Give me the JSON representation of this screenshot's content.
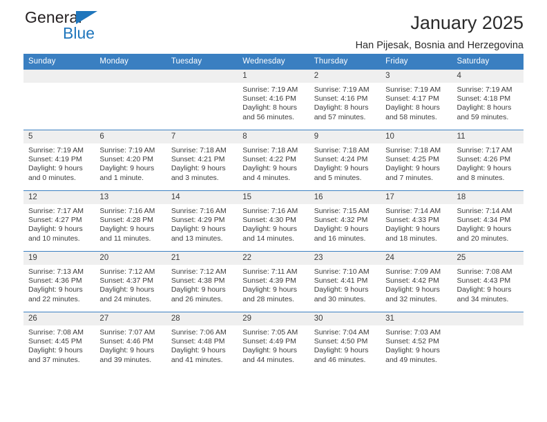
{
  "brand": {
    "line1": "General",
    "line2": "Blue",
    "accent_color": "#1f76bc",
    "triangle_icon": "brand-triangle-icon"
  },
  "header": {
    "title": "January 2025",
    "subtitle": "Han Pijesak, Bosnia and Herzegovina"
  },
  "calendar": {
    "header_bg": "#3a7fc1",
    "daynum_bg": "#efefef",
    "weekdays": [
      "Sunday",
      "Monday",
      "Tuesday",
      "Wednesday",
      "Thursday",
      "Friday",
      "Saturday"
    ],
    "weeks": [
      [
        {
          "day": "",
          "sunrise": "",
          "sunset": "",
          "daylight1": "",
          "daylight2": ""
        },
        {
          "day": "",
          "sunrise": "",
          "sunset": "",
          "daylight1": "",
          "daylight2": ""
        },
        {
          "day": "",
          "sunrise": "",
          "sunset": "",
          "daylight1": "",
          "daylight2": ""
        },
        {
          "day": "1",
          "sunrise": "Sunrise: 7:19 AM",
          "sunset": "Sunset: 4:16 PM",
          "daylight1": "Daylight: 8 hours",
          "daylight2": "and 56 minutes."
        },
        {
          "day": "2",
          "sunrise": "Sunrise: 7:19 AM",
          "sunset": "Sunset: 4:16 PM",
          "daylight1": "Daylight: 8 hours",
          "daylight2": "and 57 minutes."
        },
        {
          "day": "3",
          "sunrise": "Sunrise: 7:19 AM",
          "sunset": "Sunset: 4:17 PM",
          "daylight1": "Daylight: 8 hours",
          "daylight2": "and 58 minutes."
        },
        {
          "day": "4",
          "sunrise": "Sunrise: 7:19 AM",
          "sunset": "Sunset: 4:18 PM",
          "daylight1": "Daylight: 8 hours",
          "daylight2": "and 59 minutes."
        }
      ],
      [
        {
          "day": "5",
          "sunrise": "Sunrise: 7:19 AM",
          "sunset": "Sunset: 4:19 PM",
          "daylight1": "Daylight: 9 hours",
          "daylight2": "and 0 minutes."
        },
        {
          "day": "6",
          "sunrise": "Sunrise: 7:19 AM",
          "sunset": "Sunset: 4:20 PM",
          "daylight1": "Daylight: 9 hours",
          "daylight2": "and 1 minute."
        },
        {
          "day": "7",
          "sunrise": "Sunrise: 7:18 AM",
          "sunset": "Sunset: 4:21 PM",
          "daylight1": "Daylight: 9 hours",
          "daylight2": "and 3 minutes."
        },
        {
          "day": "8",
          "sunrise": "Sunrise: 7:18 AM",
          "sunset": "Sunset: 4:22 PM",
          "daylight1": "Daylight: 9 hours",
          "daylight2": "and 4 minutes."
        },
        {
          "day": "9",
          "sunrise": "Sunrise: 7:18 AM",
          "sunset": "Sunset: 4:24 PM",
          "daylight1": "Daylight: 9 hours",
          "daylight2": "and 5 minutes."
        },
        {
          "day": "10",
          "sunrise": "Sunrise: 7:18 AM",
          "sunset": "Sunset: 4:25 PM",
          "daylight1": "Daylight: 9 hours",
          "daylight2": "and 7 minutes."
        },
        {
          "day": "11",
          "sunrise": "Sunrise: 7:17 AM",
          "sunset": "Sunset: 4:26 PM",
          "daylight1": "Daylight: 9 hours",
          "daylight2": "and 8 minutes."
        }
      ],
      [
        {
          "day": "12",
          "sunrise": "Sunrise: 7:17 AM",
          "sunset": "Sunset: 4:27 PM",
          "daylight1": "Daylight: 9 hours",
          "daylight2": "and 10 minutes."
        },
        {
          "day": "13",
          "sunrise": "Sunrise: 7:16 AM",
          "sunset": "Sunset: 4:28 PM",
          "daylight1": "Daylight: 9 hours",
          "daylight2": "and 11 minutes."
        },
        {
          "day": "14",
          "sunrise": "Sunrise: 7:16 AM",
          "sunset": "Sunset: 4:29 PM",
          "daylight1": "Daylight: 9 hours",
          "daylight2": "and 13 minutes."
        },
        {
          "day": "15",
          "sunrise": "Sunrise: 7:16 AM",
          "sunset": "Sunset: 4:30 PM",
          "daylight1": "Daylight: 9 hours",
          "daylight2": "and 14 minutes."
        },
        {
          "day": "16",
          "sunrise": "Sunrise: 7:15 AM",
          "sunset": "Sunset: 4:32 PM",
          "daylight1": "Daylight: 9 hours",
          "daylight2": "and 16 minutes."
        },
        {
          "day": "17",
          "sunrise": "Sunrise: 7:14 AM",
          "sunset": "Sunset: 4:33 PM",
          "daylight1": "Daylight: 9 hours",
          "daylight2": "and 18 minutes."
        },
        {
          "day": "18",
          "sunrise": "Sunrise: 7:14 AM",
          "sunset": "Sunset: 4:34 PM",
          "daylight1": "Daylight: 9 hours",
          "daylight2": "and 20 minutes."
        }
      ],
      [
        {
          "day": "19",
          "sunrise": "Sunrise: 7:13 AM",
          "sunset": "Sunset: 4:36 PM",
          "daylight1": "Daylight: 9 hours",
          "daylight2": "and 22 minutes."
        },
        {
          "day": "20",
          "sunrise": "Sunrise: 7:12 AM",
          "sunset": "Sunset: 4:37 PM",
          "daylight1": "Daylight: 9 hours",
          "daylight2": "and 24 minutes."
        },
        {
          "day": "21",
          "sunrise": "Sunrise: 7:12 AM",
          "sunset": "Sunset: 4:38 PM",
          "daylight1": "Daylight: 9 hours",
          "daylight2": "and 26 minutes."
        },
        {
          "day": "22",
          "sunrise": "Sunrise: 7:11 AM",
          "sunset": "Sunset: 4:39 PM",
          "daylight1": "Daylight: 9 hours",
          "daylight2": "and 28 minutes."
        },
        {
          "day": "23",
          "sunrise": "Sunrise: 7:10 AM",
          "sunset": "Sunset: 4:41 PM",
          "daylight1": "Daylight: 9 hours",
          "daylight2": "and 30 minutes."
        },
        {
          "day": "24",
          "sunrise": "Sunrise: 7:09 AM",
          "sunset": "Sunset: 4:42 PM",
          "daylight1": "Daylight: 9 hours",
          "daylight2": "and 32 minutes."
        },
        {
          "day": "25",
          "sunrise": "Sunrise: 7:08 AM",
          "sunset": "Sunset: 4:43 PM",
          "daylight1": "Daylight: 9 hours",
          "daylight2": "and 34 minutes."
        }
      ],
      [
        {
          "day": "26",
          "sunrise": "Sunrise: 7:08 AM",
          "sunset": "Sunset: 4:45 PM",
          "daylight1": "Daylight: 9 hours",
          "daylight2": "and 37 minutes."
        },
        {
          "day": "27",
          "sunrise": "Sunrise: 7:07 AM",
          "sunset": "Sunset: 4:46 PM",
          "daylight1": "Daylight: 9 hours",
          "daylight2": "and 39 minutes."
        },
        {
          "day": "28",
          "sunrise": "Sunrise: 7:06 AM",
          "sunset": "Sunset: 4:48 PM",
          "daylight1": "Daylight: 9 hours",
          "daylight2": "and 41 minutes."
        },
        {
          "day": "29",
          "sunrise": "Sunrise: 7:05 AM",
          "sunset": "Sunset: 4:49 PM",
          "daylight1": "Daylight: 9 hours",
          "daylight2": "and 44 minutes."
        },
        {
          "day": "30",
          "sunrise": "Sunrise: 7:04 AM",
          "sunset": "Sunset: 4:50 PM",
          "daylight1": "Daylight: 9 hours",
          "daylight2": "and 46 minutes."
        },
        {
          "day": "31",
          "sunrise": "Sunrise: 7:03 AM",
          "sunset": "Sunset: 4:52 PM",
          "daylight1": "Daylight: 9 hours",
          "daylight2": "and 49 minutes."
        },
        {
          "day": "",
          "sunrise": "",
          "sunset": "",
          "daylight1": "",
          "daylight2": ""
        }
      ]
    ]
  }
}
